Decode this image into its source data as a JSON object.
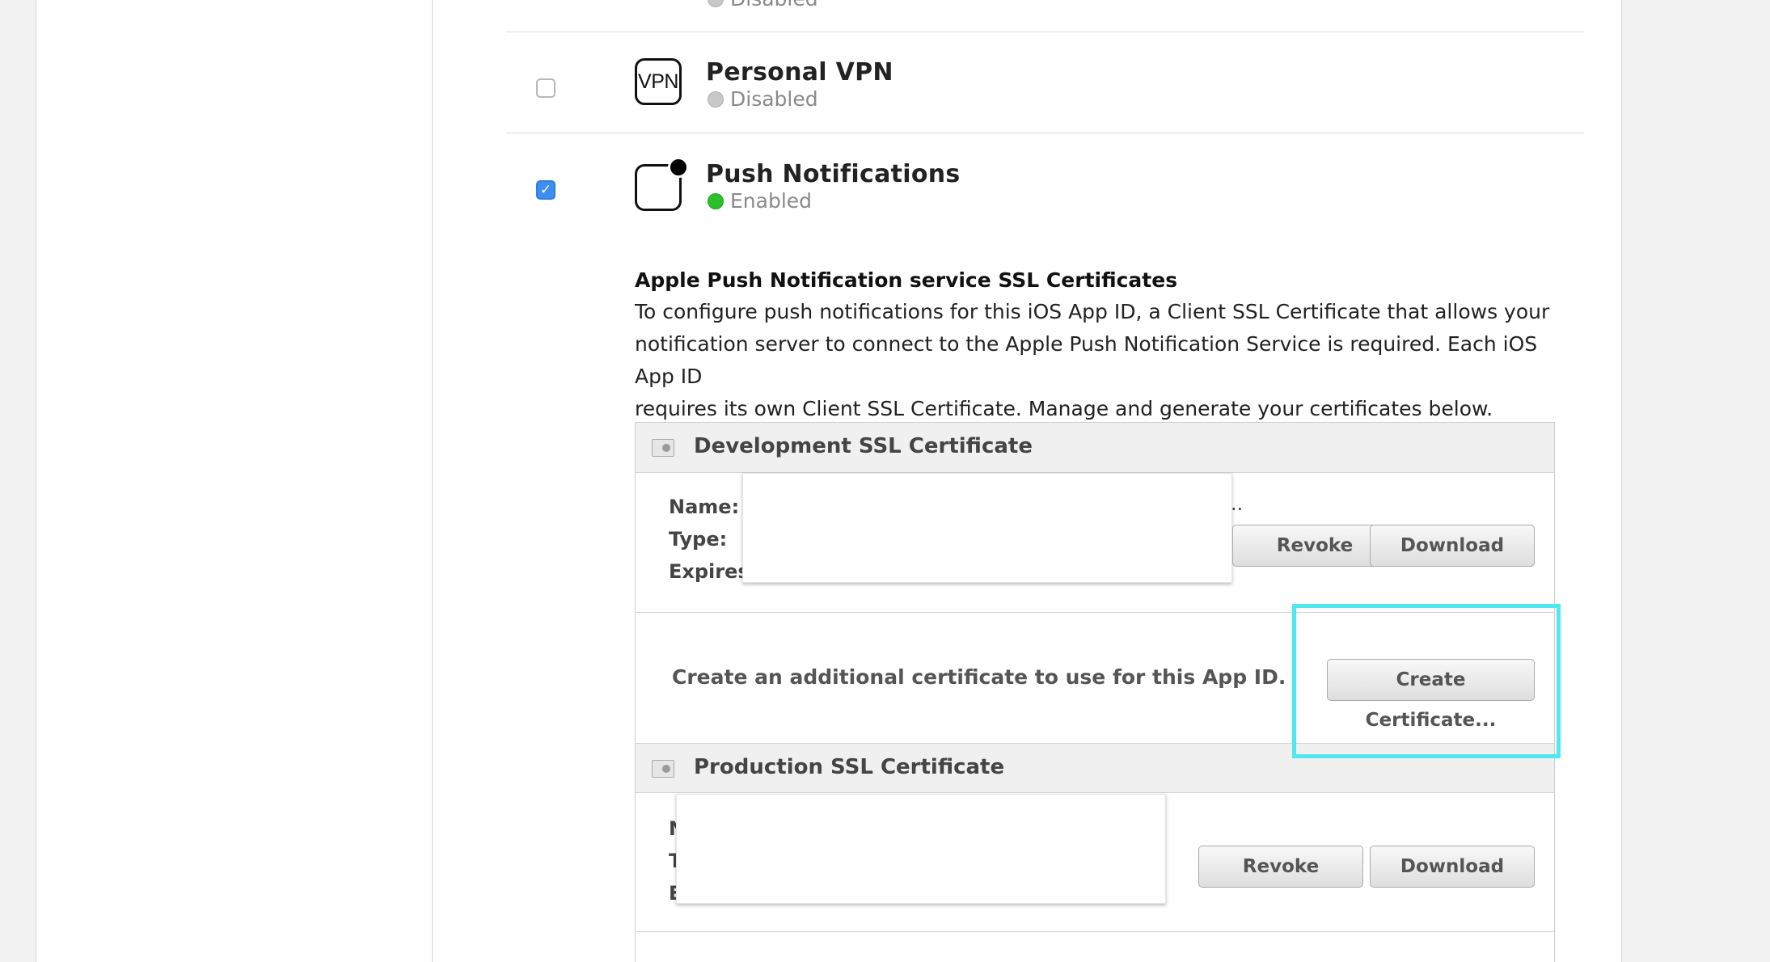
{
  "services": {
    "top_partial": {
      "status": "Disabled"
    },
    "vpn": {
      "icon_text": "VPN",
      "title": "Personal VPN",
      "status": "Disabled",
      "checked": false
    },
    "push": {
      "title": "Push Notifications",
      "status": "Enabled",
      "checked": true
    }
  },
  "apns": {
    "title": "Apple Push Notification service SSL Certificates",
    "desc_lines": [
      "To configure push notifications for this iOS App ID, a Client SSL Certificate that allows your",
      "notification server to connect to the Apple Push Notification Service is required. Each iOS App ID",
      "requires its own Client SSL Certificate. Manage and generate your certificates below."
    ]
  },
  "development": {
    "header": "Development SSL Certificate",
    "labels": {
      "name": "Name:",
      "type": "Type:",
      "expires": "Expires"
    },
    "trailing": "..",
    "revoke": "Revoke",
    "download": "Download",
    "create_text": "Create an additional certificate to use for this App ID.",
    "create_button": "Create Certificate..."
  },
  "production": {
    "header": "Production SSL Certificate",
    "labels": {
      "name": "N",
      "type": "T",
      "expires": "E"
    },
    "revoke": "Revoke",
    "download": "Download"
  },
  "colors": {
    "highlight": "#4ee8ee",
    "checkbox_checked": "#3d8ef0",
    "enabled_dot": "#2bbf2b",
    "disabled_dot": "#c8c8c8"
  }
}
